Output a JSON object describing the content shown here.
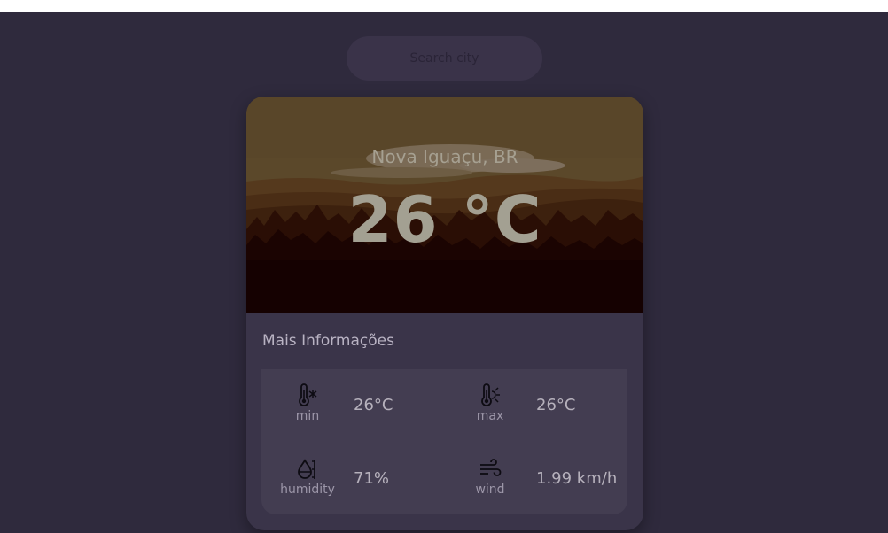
{
  "search": {
    "placeholder": "Search city"
  },
  "weather": {
    "location": "Nova Iguaçu, BR",
    "temperature": "26 °C"
  },
  "details": {
    "title": "Mais Informações",
    "items": [
      {
        "label": "min",
        "value": "26°C",
        "icon": "thermometer-snowflake-icon"
      },
      {
        "label": "max",
        "value": "26°C",
        "icon": "thermometer-sun-icon"
      },
      {
        "label": "humidity",
        "value": "71%",
        "icon": "droplet-gauge-icon"
      },
      {
        "label": "wind",
        "value": "1.99 km/h",
        "icon": "wind-icon"
      }
    ]
  },
  "colors": {
    "background": "#2f2a3d",
    "card": "#3a3449",
    "panel": "#433d51",
    "hero_sky": "#5e4a2c",
    "hero_ground": "#150101"
  }
}
